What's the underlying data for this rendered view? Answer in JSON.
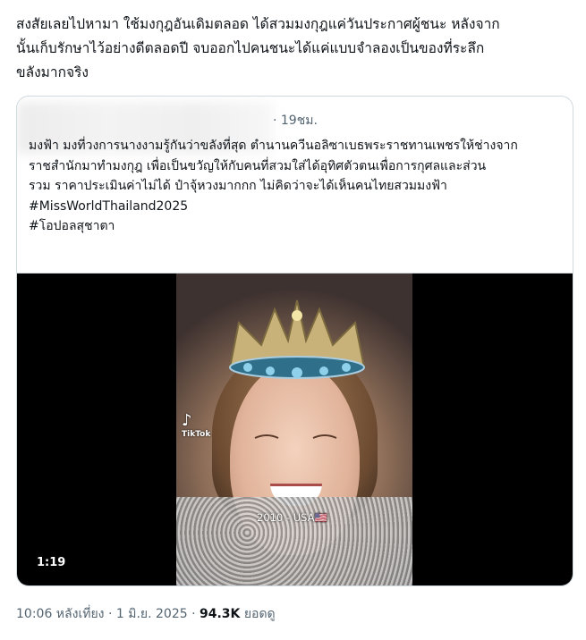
{
  "tweet": {
    "text_lines": [
      "สงสัยเลยไปหามา ใช้มงกุฎอันเดิมตลอด ได้สวมมงกุฎแค่วันประกาศผู้ชนะ หลังจาก",
      "นั้นเก็บรักษาไว้อย่างดีตลอดปี จบออกไปคนชนะได้แค่แบบจำลองเป็นของที่ระลึก",
      "ขลังมากจริง"
    ]
  },
  "quote": {
    "time": "· 19ชม.",
    "body_lines": [
      "มงฟ้า มงที่วงการนางงามรู้กันว่าขลังที่สุด ตำนานควีนอลิซาเบธพระราชทานเพชรให้ช่างจาก",
      "ราชสำนักมาทำมงกุฎ เพื่อเป็นขวัญให้กับคนที่สวมใส่ได้อุทิศตัวตนเพื่อการกุศลและส่วน",
      "รวม ราคาประเมินค่าไม่ได้ ป๋าจุ้หวงมากกก ไม่คิดว่าจะได้เห็นคนไทยสวมมงฟ้า"
    ],
    "hashtags": [
      "#MissWorldThailand2025",
      "#โอปอลสุชาตา"
    ],
    "video": {
      "watermark": "TikTok",
      "caption": "2010 - USA🇺🇸",
      "duration": "1:19"
    }
  },
  "meta": {
    "time": "10:06 หลังเที่ยง",
    "sep1": " · ",
    "date": "1 มิ.ย. 2025",
    "sep2": " · ",
    "views": "94.3K",
    "views_label": " ยอดดู"
  }
}
